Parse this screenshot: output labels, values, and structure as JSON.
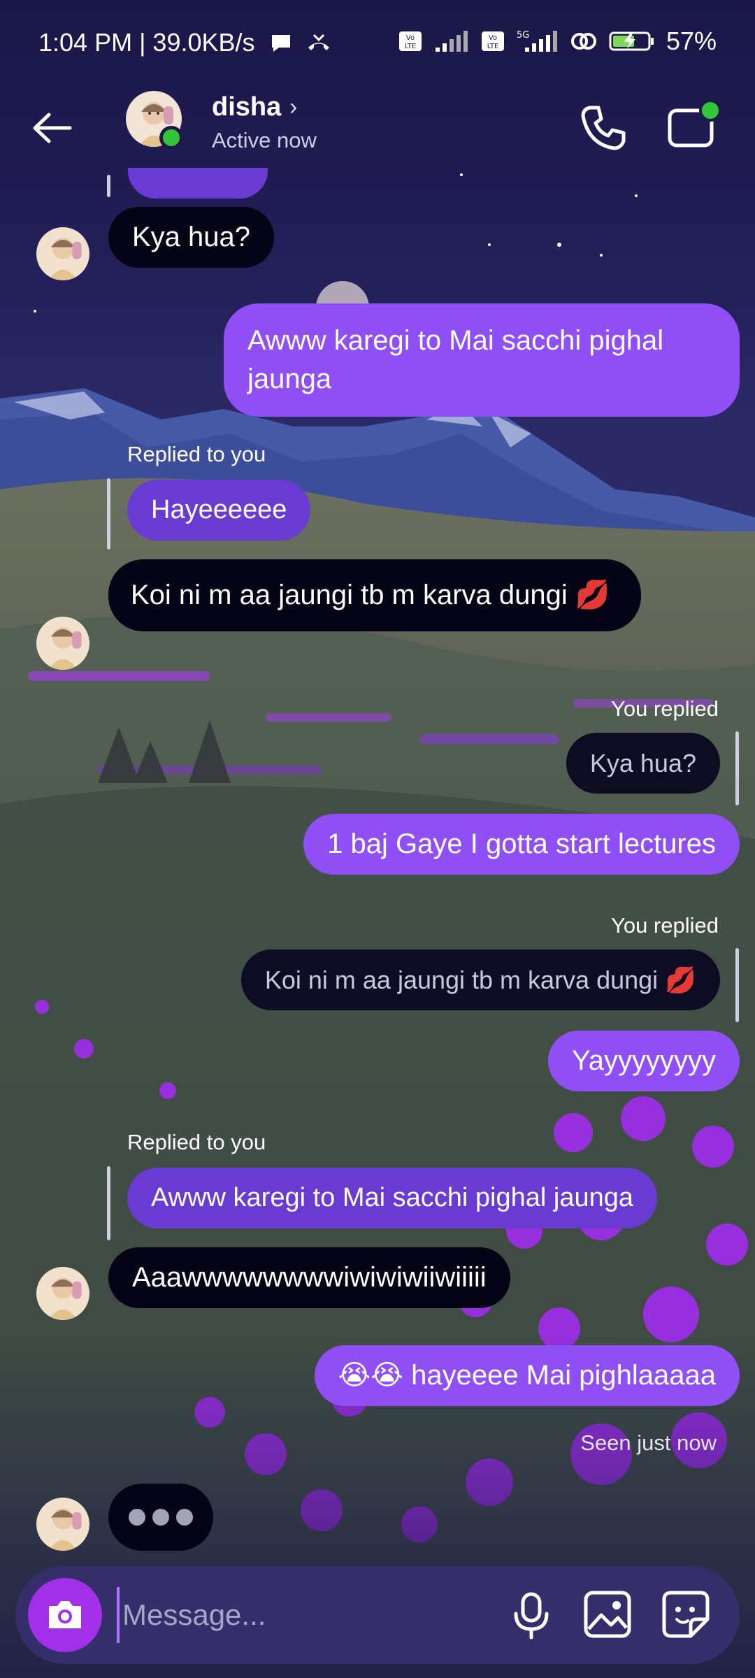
{
  "status_bar": {
    "time": "1:04 PM | 39.0KB/s",
    "battery": "57%",
    "network": "5G"
  },
  "header": {
    "contact_name": "disha",
    "status": "Active now"
  },
  "messages": [
    {
      "from": "them",
      "text": "Kya hua?"
    },
    {
      "from": "me",
      "text": "Awww karegi to Mai sacchi pighal jaunga"
    },
    {
      "from": "them",
      "reply_label": "Replied to you",
      "quoted": "Hayeeeeee",
      "text": "Koi ni m aa jaungi tb m karva dungi 💋"
    },
    {
      "from": "me",
      "reply_label": "You replied",
      "quoted": "Kya hua?",
      "text": "1 baj Gaye I gotta start lectures"
    },
    {
      "from": "me",
      "reply_label": "You replied",
      "quoted": "Koi ni m aa jaungi tb m karva dungi 💋",
      "text": "Yayyyyyyyy"
    },
    {
      "from": "them",
      "reply_label": "Replied to you",
      "quoted": "Awww karegi to Mai sacchi pighal jaunga",
      "text": "Aaawwwwwwwwiwiwiwiiwiiiii"
    },
    {
      "from": "me",
      "text": "😭😭 hayeeee Mai pighlaaaaa"
    }
  ],
  "seen_text": "Seen just now",
  "composer": {
    "placeholder": "Message..."
  },
  "colors": {
    "outgoing_bubble": "#8f4ff4",
    "incoming_bubble": "#050417",
    "reply_quote_in": "#6a3bd2",
    "online_dot": "#34c53a",
    "camera_button": "#a230e8",
    "composer_bg": "#342e6b"
  },
  "icons": [
    "back-arrow-icon",
    "phone-icon",
    "video-call-icon",
    "camera-icon",
    "microphone-icon",
    "gallery-icon",
    "sticker-icon",
    "chevron-right-icon"
  ]
}
